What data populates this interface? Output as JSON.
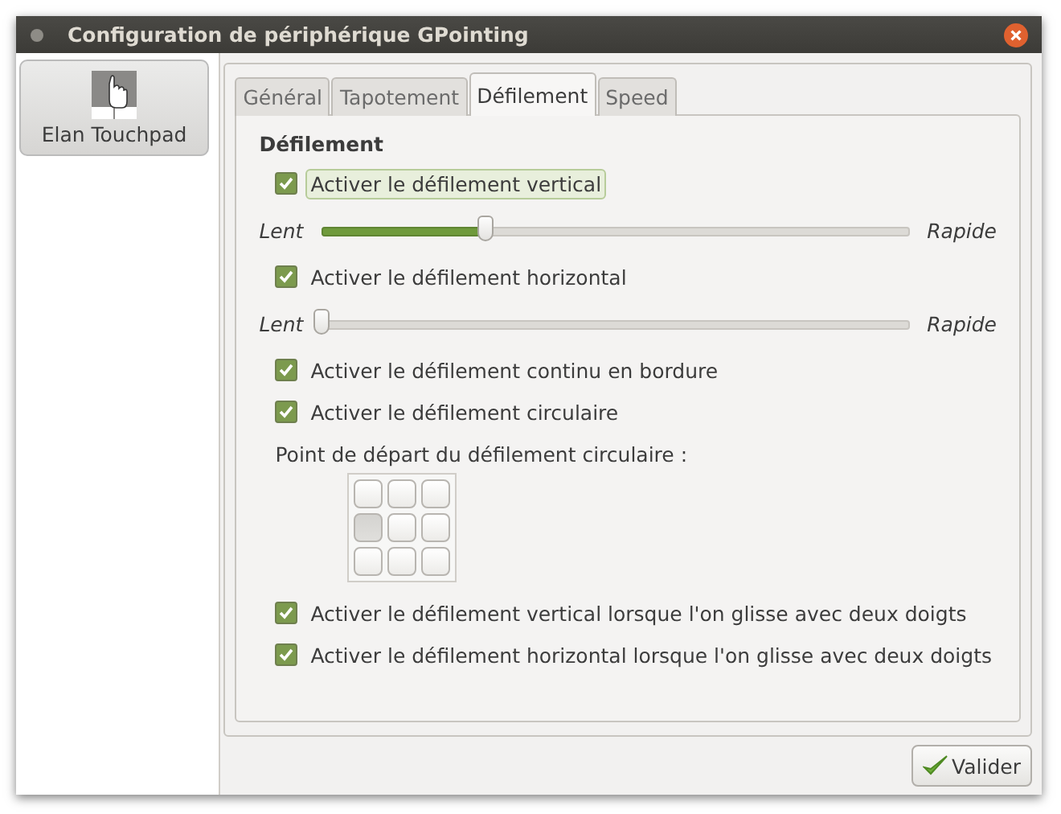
{
  "window": {
    "title": "Configuration de périphérique GPointing"
  },
  "devices": [
    {
      "name": "Elan Touchpad",
      "selected": true
    }
  ],
  "tabs": [
    {
      "label": "Général",
      "selected": false
    },
    {
      "label": "Tapotement",
      "selected": false
    },
    {
      "label": "Défilement",
      "selected": true
    },
    {
      "label": "Speed",
      "selected": false
    }
  ],
  "section": {
    "title": "Défilement"
  },
  "items": [
    {
      "kind": "checkbox",
      "label": "Activer le défilement vertical",
      "checked": true,
      "focused": true
    },
    {
      "kind": "slider",
      "min_label": "Lent",
      "max_label": "Rapide",
      "level": 0.28
    },
    {
      "kind": "checkbox",
      "label": "Activer le défilement horizontal",
      "checked": true,
      "focused": false
    },
    {
      "kind": "slider",
      "min_label": "Lent",
      "max_label": "Rapide",
      "level": 0.0
    },
    {
      "kind": "checkbox",
      "label": "Activer le défilement continu en bordure",
      "checked": true,
      "focused": false
    },
    {
      "kind": "checkbox",
      "label": "Activer le défilement circulaire",
      "checked": true,
      "focused": false
    },
    {
      "kind": "label",
      "label": "Point de départ du défilement circulaire :"
    },
    {
      "kind": "grid",
      "cells": [
        {
          "selected": false
        },
        {
          "selected": false
        },
        {
          "selected": false
        },
        {
          "selected": true
        },
        {
          "selected": false
        },
        {
          "selected": false
        },
        {
          "selected": false
        },
        {
          "selected": false
        },
        {
          "selected": false
        }
      ]
    },
    {
      "kind": "checkbox",
      "label": "Activer le défilement vertical lorsque l'on glisse avec deux doigts",
      "checked": true,
      "focused": false
    },
    {
      "kind": "checkbox",
      "label": "Activer le défilement horizontal lorsque l'on glisse avec deux doigts",
      "checked": true,
      "focused": false
    }
  ],
  "buttons": [
    {
      "label": "Valider"
    }
  ]
}
